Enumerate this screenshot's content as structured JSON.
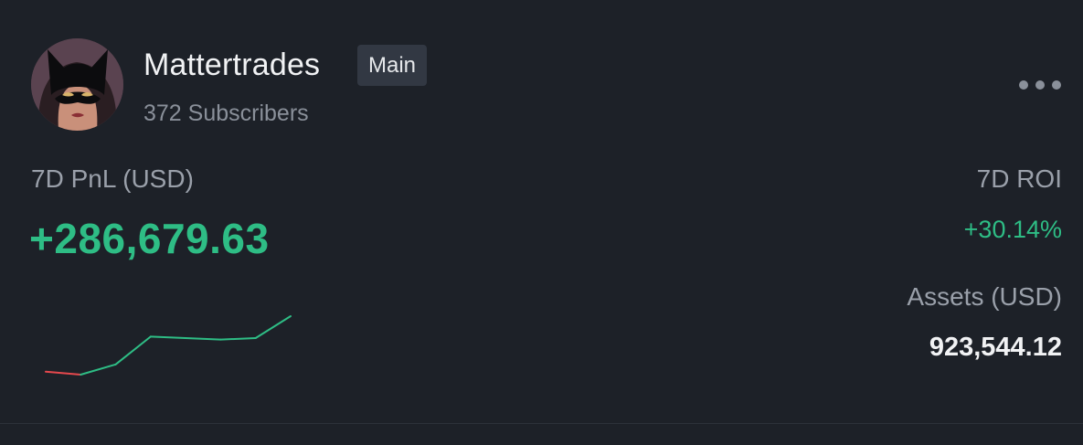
{
  "profile": {
    "username": "Mattertrades",
    "badge": "Main",
    "subscribers": "372 Subscribers",
    "avatar_icon": "masked-character-avatar"
  },
  "menu": {
    "icon": "more-horizontal-icon"
  },
  "pnl": {
    "label": "7D PnL (USD)",
    "value": "+286,679.63"
  },
  "roi": {
    "label": "7D ROI",
    "value": "+30.14%"
  },
  "assets": {
    "label": "Assets (USD)",
    "value": "923,544.12"
  },
  "colors": {
    "background": "#1d2128",
    "positive": "#2ebd85",
    "negative": "#e5484d",
    "badge_bg": "#323843",
    "muted_text": "#8a909a"
  },
  "chart_data": {
    "type": "line",
    "x": [
      1,
      2,
      3,
      4,
      5,
      6,
      7,
      8
    ],
    "values": [
      -0.2,
      -0.4,
      0.3,
      2.2,
      2.1,
      2.0,
      2.1,
      3.6
    ],
    "negative_color": "#e5484d",
    "positive_color": "#2ebd85"
  }
}
